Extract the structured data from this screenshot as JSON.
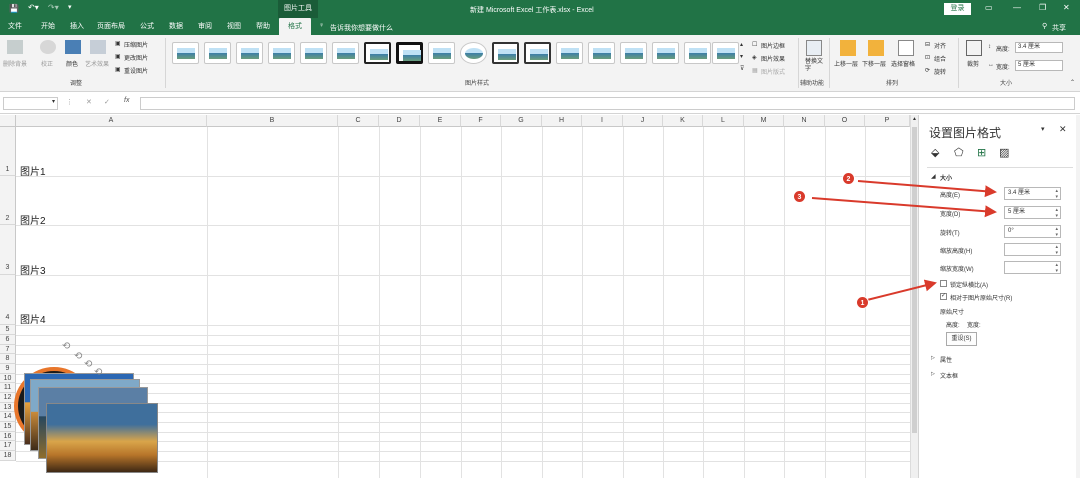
{
  "window": {
    "title": "新建 Microsoft Excel 工作表.xlsx - Excel",
    "context_tool": "图片工具",
    "login": "登录",
    "share": "共享"
  },
  "tabs": [
    "文件",
    "开始",
    "插入",
    "页面布局",
    "公式",
    "数据",
    "审阅",
    "视图",
    "帮助",
    "格式"
  ],
  "tell_me": "告诉我你想要做什么",
  "ribbon": {
    "adjust": {
      "remove_bg": "删除背景",
      "correct": "校正",
      "color": "颜色",
      "artistic": "艺术效果",
      "compress": "压缩图片",
      "change": "更改图片",
      "reset": "重设图片",
      "label": "调整"
    },
    "styles": {
      "label": "图片样式",
      "border": "图片边框",
      "effects": "图片效果",
      "layout": "图片版式"
    },
    "access": {
      "alt_text": "替换文字",
      "label": "辅助功能"
    },
    "arrange": {
      "forward": "上移一层",
      "backward": "下移一层",
      "selection": "选择窗格",
      "align": "对齐",
      "group": "组合",
      "rotate": "旋转",
      "label": "排列"
    },
    "size": {
      "crop": "裁剪",
      "height_lbl": "高度:",
      "height_val": "3.4 厘米",
      "width_lbl": "宽度:",
      "width_val": "5 厘米",
      "label": "大小"
    }
  },
  "formula_bar": {
    "fx": "fx"
  },
  "columns": [
    "A",
    "B",
    "C",
    "D",
    "E",
    "F",
    "G",
    "H",
    "I",
    "J",
    "K",
    "L",
    "M",
    "N",
    "O",
    "P"
  ],
  "rows": [
    "1",
    "2",
    "3",
    "4",
    "5",
    "6",
    "7",
    "8",
    "9",
    "10",
    "11",
    "12",
    "13",
    "14",
    "15",
    "16",
    "17",
    "18"
  ],
  "cells": {
    "a1": "图片1",
    "a2": "图片2",
    "a3": "图片3",
    "a4": "图片4"
  },
  "panel": {
    "title": "设置图片格式",
    "section_size": "大小",
    "height_lbl": "高度(E)",
    "height_val": "3.4 厘米",
    "width_lbl": "宽度(D)",
    "width_val": "5 厘米",
    "rotate_lbl": "旋转(T)",
    "rotate_val": "0°",
    "scale_h_lbl": "缩放高度(H)",
    "scale_w_lbl": "缩放宽度(W)",
    "lock_ratio": "锁定纵横比(A)",
    "relative": "相对于图片原始尺寸(R)",
    "original": "原始尺寸",
    "orig_h": "高度:",
    "orig_w": "宽度:",
    "reset": "重设(S)",
    "properties": "属性",
    "textbox": "文本框"
  },
  "badges": [
    "1",
    "2",
    "3"
  ],
  "colors": {
    "excel_green": "#217346",
    "badge_red": "#d93a2b"
  }
}
